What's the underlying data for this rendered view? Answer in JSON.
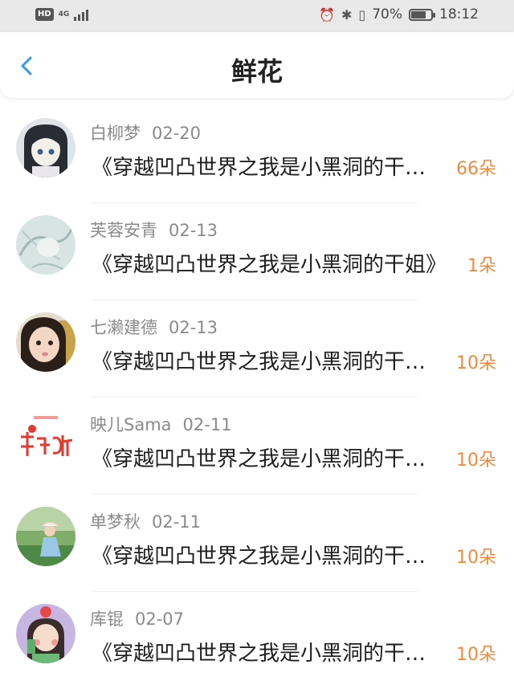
{
  "status_bar": {
    "hd": "HD",
    "network": "4G",
    "battery_text": "70%",
    "battery_level": 0.7,
    "time": "18:12"
  },
  "header": {
    "title": "鲜花"
  },
  "items": [
    {
      "name": "白柳梦",
      "date": "02-20",
      "book": "《穿越凹凸世界之我是小黑洞的干…",
      "count": "66朵",
      "avatar": "anime-girl-avatar"
    },
    {
      "name": "芙蓉安青",
      "date": "02-13",
      "book": "《穿越凹凸世界之我是小黑洞的干姐》",
      "count": "1朵",
      "avatar": "sketch-avatar"
    },
    {
      "name": "七濑建德",
      "date": "02-13",
      "book": "《穿越凹凸世界之我是小黑洞的干…",
      "count": "10朵",
      "avatar": "photo-girl-avatar"
    },
    {
      "name": "映儿Sama",
      "date": "02-11",
      "book": "《穿越凹凸世界之我是小黑洞的干…",
      "count": "10朵",
      "avatar": "shoujibaoting-logo-avatar"
    },
    {
      "name": "单梦秋",
      "date": "02-11",
      "book": "《穿越凹凸世界之我是小黑洞的干…",
      "count": "10朵",
      "avatar": "outdoor-photo-avatar"
    },
    {
      "name": "库锟",
      "date": "02-07",
      "book": "《穿越凹凸世界之我是小黑洞的干…",
      "count": "10朵",
      "avatar": "cartoon-girl-avatar"
    }
  ],
  "colors": {
    "accent": "#f08a3c",
    "back": "#2f9be8"
  }
}
